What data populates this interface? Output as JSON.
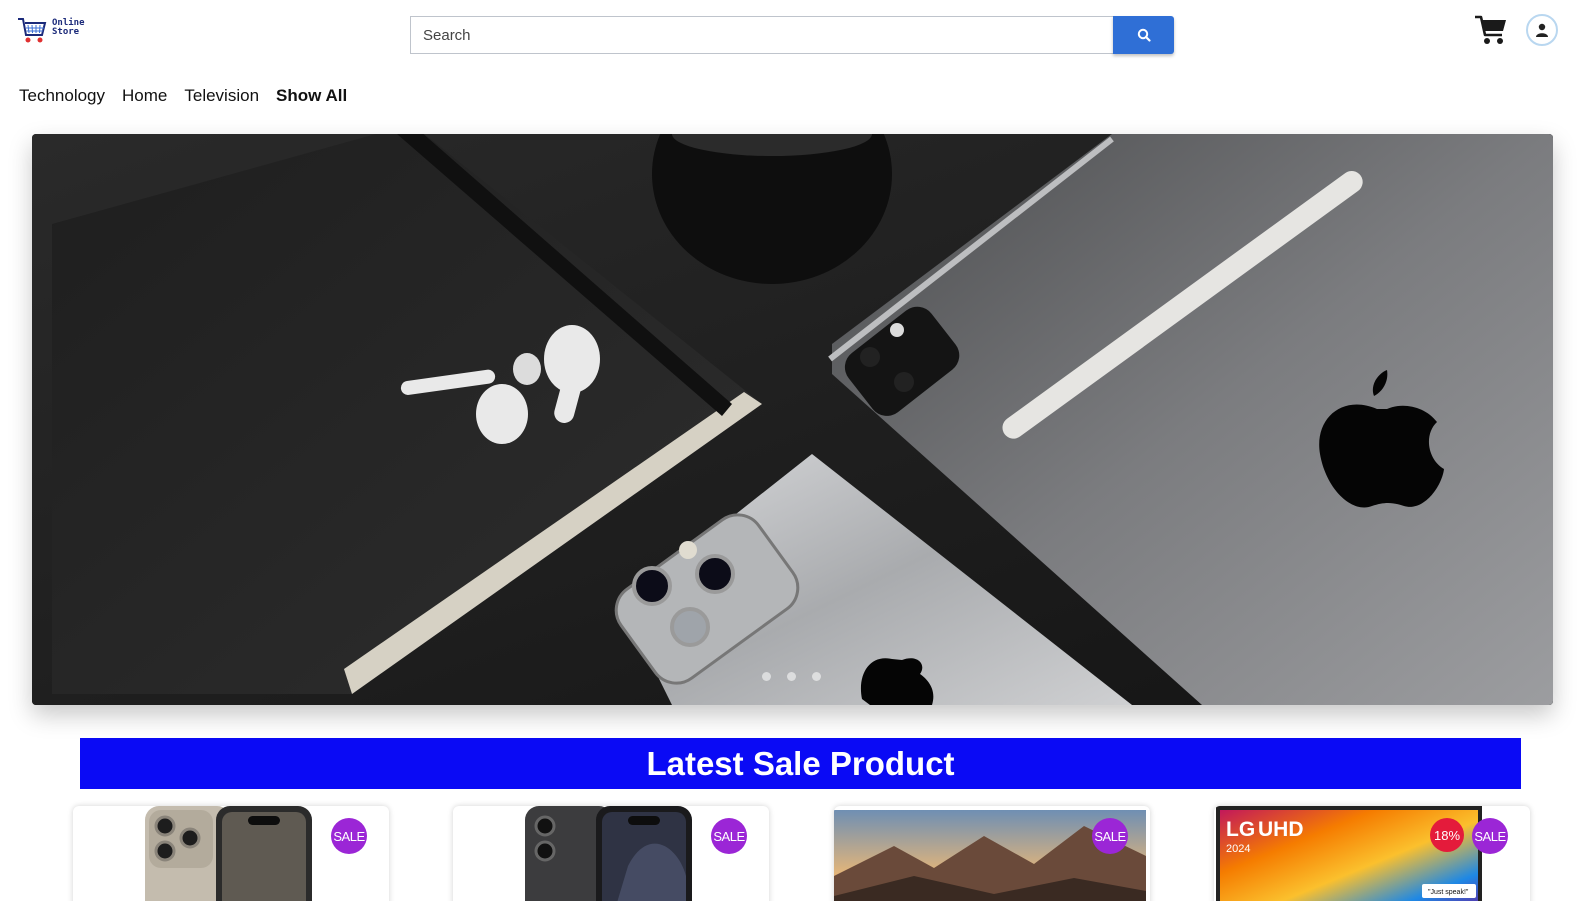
{
  "header": {
    "logo_line1": "Online",
    "logo_line2": "Store",
    "search_placeholder": "Search",
    "search_icon": "search-icon",
    "cart_icon": "cart-icon",
    "user_icon": "user-icon"
  },
  "nav": {
    "items": [
      {
        "label": "Technology"
      },
      {
        "label": "Home"
      },
      {
        "label": "Television"
      },
      {
        "label": "Show All"
      }
    ]
  },
  "hero": {
    "slides": 3,
    "active_slide": 1
  },
  "sale_section": {
    "title": "Latest Sale Product"
  },
  "products": [
    {
      "badge": "SALE",
      "kind": "iphone-titanium"
    },
    {
      "badge": "SALE",
      "kind": "iphone-black"
    },
    {
      "badge": "SALE",
      "kind": "tv-landscape"
    },
    {
      "badge": "SALE",
      "discount": "18%",
      "kind": "lg-tv",
      "tv_brand": "LG",
      "tv_model": "UHD",
      "tv_year": "2024",
      "tv_tagline": "\"Just speak!\""
    }
  ],
  "colors": {
    "search_button": "#2f6fd6",
    "banner": "#0a0af5",
    "sale_badge": "#9b26d6",
    "discount_badge": "#e41b3b"
  }
}
